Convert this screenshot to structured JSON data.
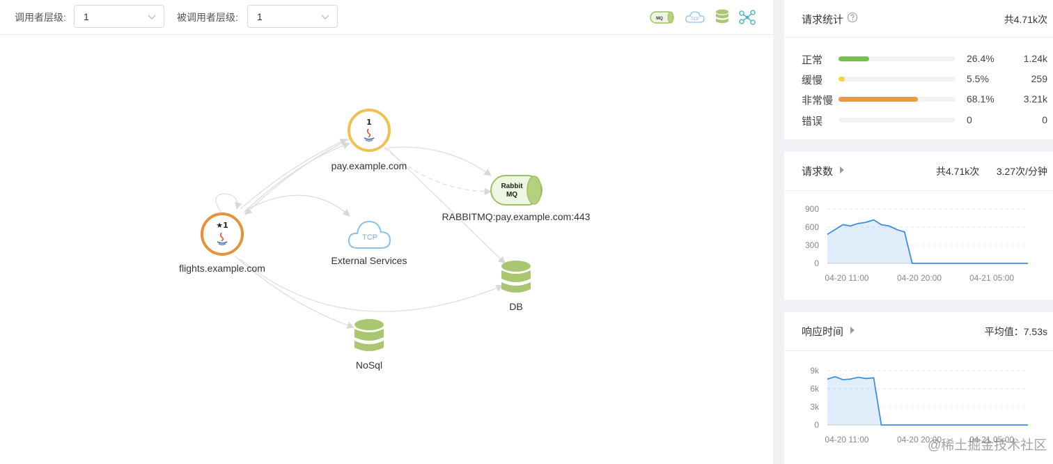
{
  "toolbar": {
    "caller_label": "调用者层级:",
    "caller_value": "1",
    "callee_label": "被调用者层级:",
    "callee_value": "1",
    "legend_icons": [
      "mq-icon",
      "tcp-cloud-icon",
      "database-icon",
      "topology-icon"
    ],
    "mq_icon_text": "MQ",
    "tcp_icon_text": "TCP"
  },
  "graph": {
    "nodes": [
      {
        "id": "flights",
        "label": "flights.example.com",
        "kind": "java-app",
        "badge": "★1",
        "ring_color": "#e8903a"
      },
      {
        "id": "pay",
        "label": "pay.example.com",
        "kind": "java-app",
        "badge": "1",
        "ring_color": "#f0c050"
      },
      {
        "id": "rabbit",
        "label": "RABBITMQ:pay.example.com:443",
        "kind": "mq",
        "line1": "Rabbit",
        "line2": "MQ"
      },
      {
        "id": "tcp",
        "label": "External Services",
        "kind": "tcp",
        "icon_text": "TCP"
      },
      {
        "id": "db",
        "label": "DB",
        "kind": "database"
      },
      {
        "id": "nosql",
        "label": "NoSql",
        "kind": "database"
      }
    ]
  },
  "request_stats": {
    "title": "请求统计",
    "total": "共4.71k次",
    "rows": [
      {
        "name": "正常",
        "pct": "26.4%",
        "count": "1.24k",
        "fraction": 0.264,
        "color": "#73c24a"
      },
      {
        "name": "缓慢",
        "pct": "5.5%",
        "count": "259",
        "fraction": 0.055,
        "color": "#f5d33b"
      },
      {
        "name": "非常慢",
        "pct": "68.1%",
        "count": "3.21k",
        "fraction": 0.681,
        "color": "#ee9a3a"
      },
      {
        "name": "错误",
        "pct": "0",
        "count": "0",
        "fraction": 0,
        "color": "#e05050"
      }
    ]
  },
  "request_count": {
    "title": "请求数",
    "total": "共4.71k次",
    "rate": "3.27次/分钟",
    "chart_data": {
      "type": "area",
      "y_ticks": [
        "900",
        "600",
        "300",
        "0"
      ],
      "ylim": [
        0,
        900
      ],
      "x_ticks": [
        "04-20 11:00",
        "04-20 20:00",
        "04-21 05:00"
      ],
      "values": [
        480,
        560,
        640,
        620,
        660,
        680,
        720,
        640,
        620,
        560,
        520,
        0,
        0,
        0,
        0,
        0,
        0,
        0,
        0,
        0,
        0,
        0,
        0,
        0,
        0,
        0,
        0
      ],
      "color": "#3d8de0",
      "grid": true
    }
  },
  "response_time": {
    "title": "响应时间",
    "avg_text": "平均值：7.53s",
    "chart_data": {
      "type": "area",
      "y_ticks": [
        "9k",
        "6k",
        "3k",
        "0"
      ],
      "ylim": [
        0,
        9000
      ],
      "x_ticks": [
        "04-20 11:00",
        "04-20 20:00",
        "04-21 05:00"
      ],
      "values": [
        7600,
        8000,
        7500,
        7600,
        7900,
        7700,
        7800,
        0,
        0,
        0,
        0,
        0,
        0,
        0,
        0,
        0,
        0,
        0,
        0,
        0,
        0,
        0,
        0,
        0,
        0,
        0,
        0
      ],
      "color": "#3d8de0",
      "grid": true
    }
  },
  "watermark": "@稀土掘金技术社区"
}
